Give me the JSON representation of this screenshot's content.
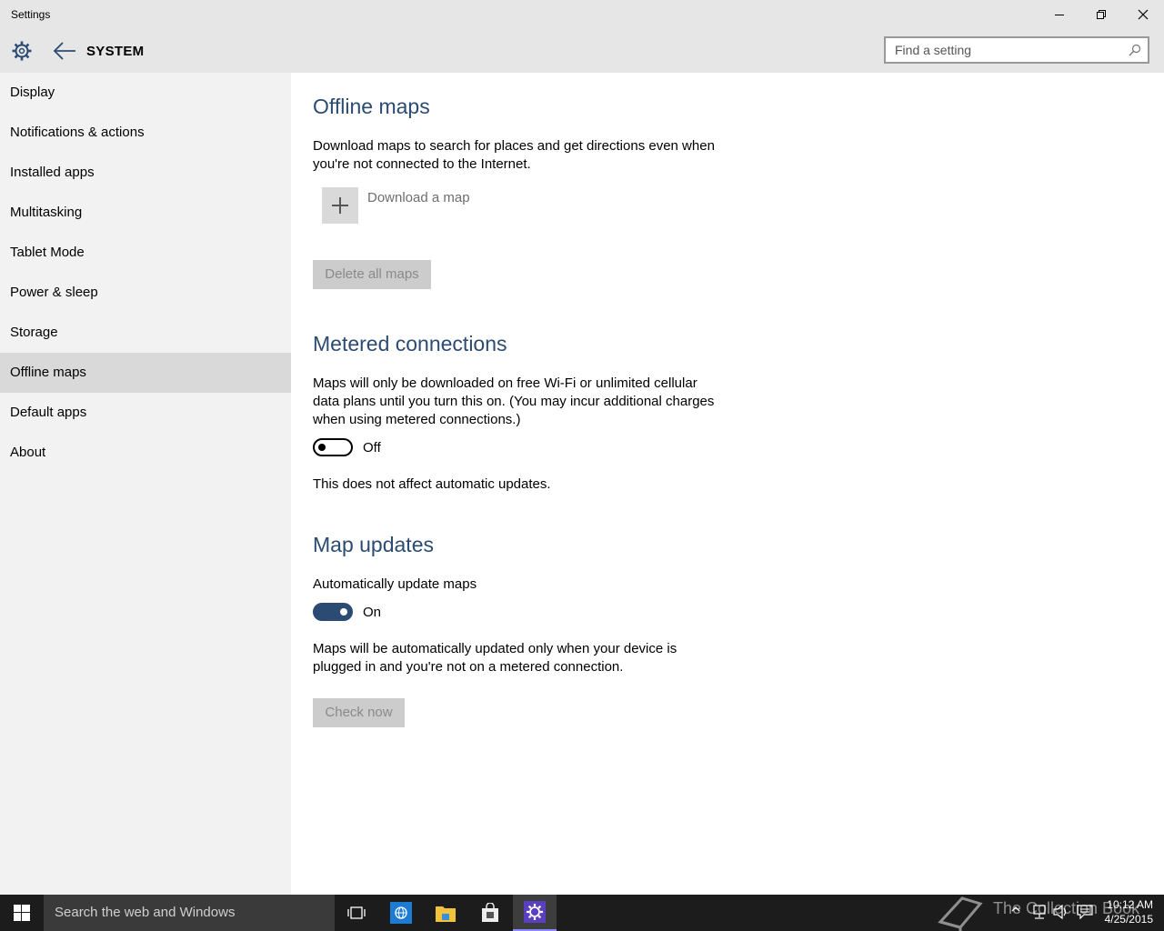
{
  "window": {
    "title": "Settings"
  },
  "header": {
    "section": "SYSTEM",
    "search_placeholder": "Find a setting"
  },
  "sidebar": {
    "items": [
      {
        "label": "Display"
      },
      {
        "label": "Notifications & actions"
      },
      {
        "label": "Installed apps"
      },
      {
        "label": "Multitasking"
      },
      {
        "label": "Tablet Mode"
      },
      {
        "label": "Power & sleep"
      },
      {
        "label": "Storage"
      },
      {
        "label": "Offline maps",
        "active": true
      },
      {
        "label": "Default apps"
      },
      {
        "label": "About"
      }
    ]
  },
  "main": {
    "offline_maps": {
      "heading": "Offline maps",
      "description": "Download maps to search for places and get directions even when you're not connected to the Internet.",
      "download_label": "Download a map",
      "delete_button": "Delete all maps"
    },
    "metered": {
      "heading": "Metered connections",
      "description": "Maps will only be downloaded on free Wi-Fi or unlimited cellular data plans until you turn this on. (You may incur additional charges when using metered connections.)",
      "toggle_state": "Off",
      "note": "This does not affect automatic updates."
    },
    "updates": {
      "heading": "Map updates",
      "auto_label": "Automatically update maps",
      "toggle_state": "On",
      "description": "Maps will be automatically updated only when your device is plugged in and you're not on a metered connection.",
      "check_button": "Check now"
    }
  },
  "taskbar": {
    "search_placeholder": "Search the web and Windows",
    "watermark": "The Collection Book",
    "time": "10:12 AM",
    "date": "4/25/2015"
  },
  "colors": {
    "accent": "#2b4b72",
    "sidebar_bg": "#f2f2f2",
    "selected_bg": "#d9d9d9",
    "taskbar_bg": "#1c1c1c"
  }
}
